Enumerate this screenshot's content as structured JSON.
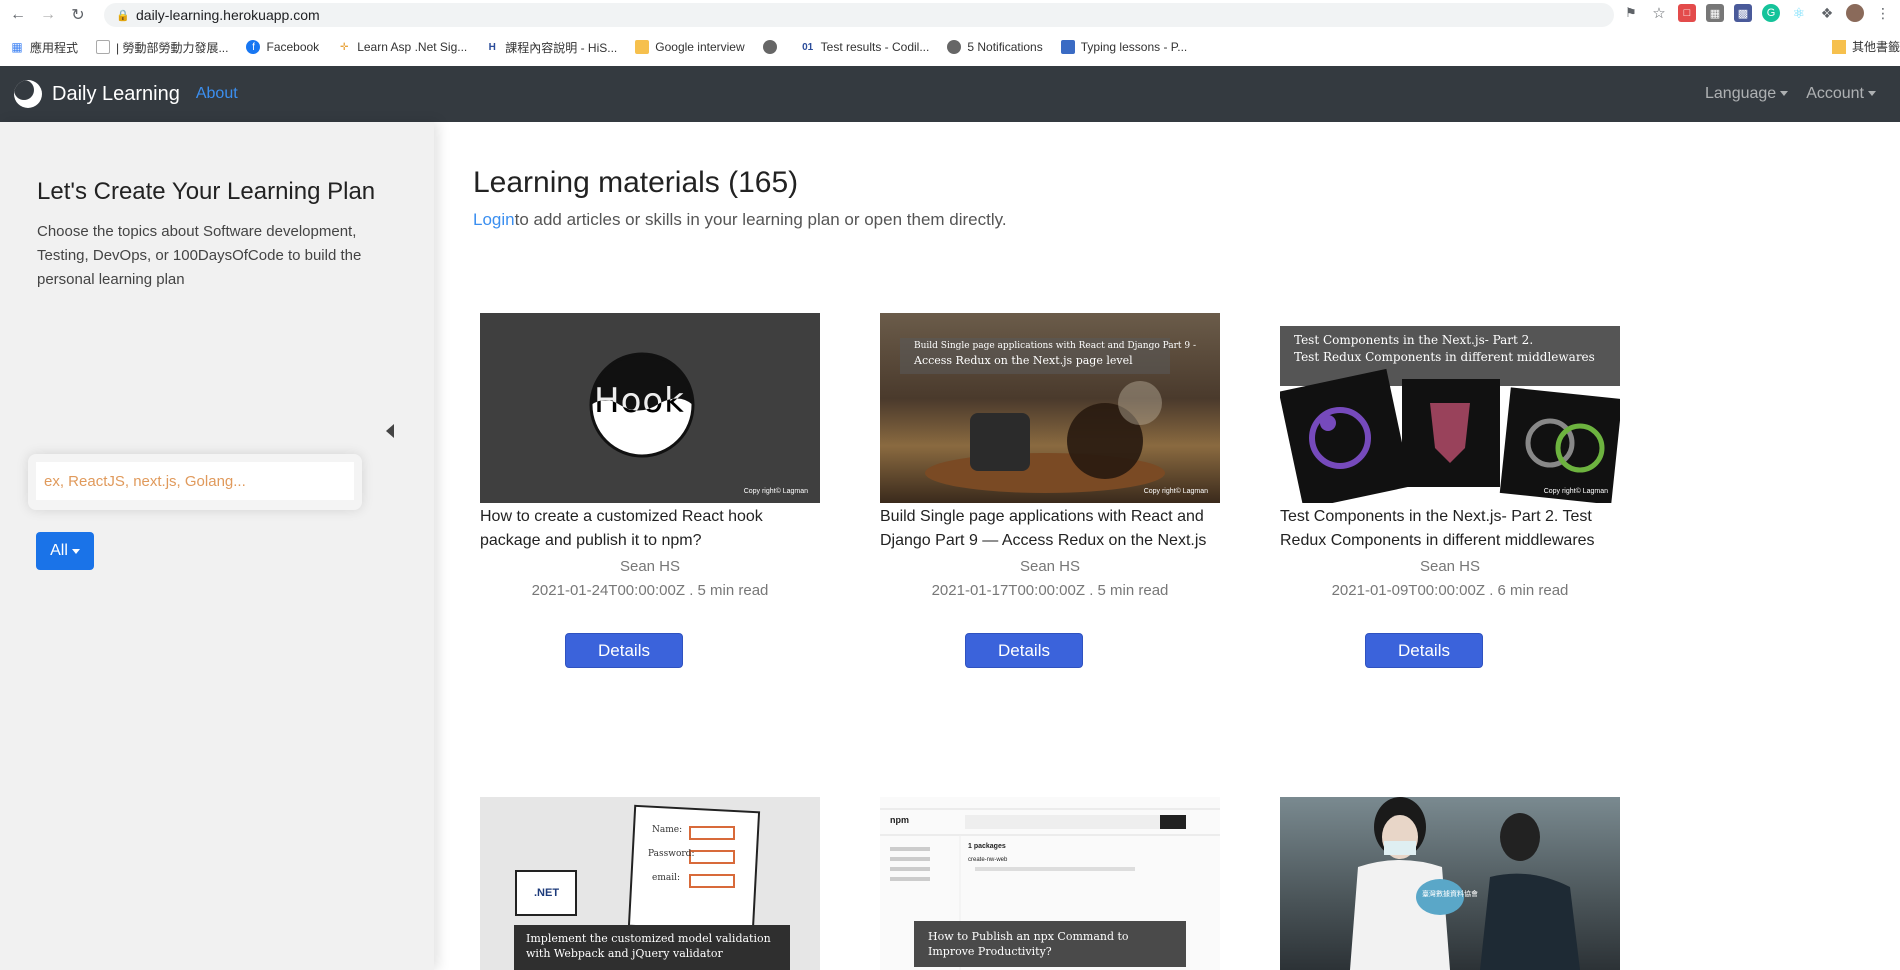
{
  "browser": {
    "url": "daily-learning.herokuapp.com",
    "bookmarks": [
      {
        "label": "應用程式",
        "icon": "apps-grid-icon"
      },
      {
        "label": "| 勞動部勞動力發展...",
        "icon": "page-icon"
      },
      {
        "label": "Facebook",
        "icon": "facebook-icon"
      },
      {
        "label": "Learn Asp .Net Sig...",
        "icon": "bookmark-icon"
      },
      {
        "label": "課程內容說明 - HiS...",
        "icon": "h-icon"
      },
      {
        "label": "Google interview",
        "icon": "folder-icon"
      },
      {
        "label": "",
        "icon": "globe-icon"
      },
      {
        "label": "Test results - Codil...",
        "icon": "codility-icon"
      },
      {
        "label": "5 Notifications",
        "icon": "globe-icon"
      },
      {
        "label": "Typing lessons - P...",
        "icon": "typing-icon"
      }
    ],
    "bookmark_other": "其他書籤"
  },
  "navbar": {
    "brand": "Daily Learning",
    "about": "About",
    "language": "Language",
    "account": "Account"
  },
  "sidebar": {
    "title": "Let's Create Your Learning Plan",
    "description": "Choose the topics about Software development, Testing, DevOps, or 100DaysOfCode to build the personal learning plan",
    "search_placeholder": "ex, ReactJS, next.js, Golang...",
    "filter_label": "All"
  },
  "main": {
    "title": "Learning materials (165)",
    "login_link": "Login",
    "subtitle_rest": "to add articles or skills in your learning plan or open them directly.",
    "details_label": "Details",
    "cards": [
      {
        "title": "How to create a customized React hook package and publish it to npm?",
        "author": "Sean HS",
        "meta": "2021-01-24T00:00:00Z . 5 min read",
        "image_text": "Hook",
        "image_caption": "",
        "copyright": "Copy right© Lagman"
      },
      {
        "title": "Build Single page applications with React and Django Part 9 — Access Redux on the Next.js",
        "author": "Sean HS",
        "meta": "2021-01-17T00:00:00Z . 5 min read",
        "image_text": "Build Single page applications with React and Django Part 9 -",
        "image_caption": "Access Redux on the Next.js page level",
        "copyright": "Copy right© Lagman"
      },
      {
        "title": "Test Components in the Next.js- Part 2. Test Redux Components in different middlewares",
        "author": "Sean HS",
        "meta": "2021-01-09T00:00:00Z . 6 min read",
        "image_text": "Test Components in the Next.js- Part 2.",
        "image_caption": "Test Redux Components in different middlewares",
        "copyright": "Copy right© Lagman"
      },
      {
        "image_text": "Implement the customized model validation",
        "image_caption": "with Webpack and jQuery validator",
        "form_labels": [
          "Name:",
          "Password:",
          "email:"
        ],
        "logo_text": ".NET"
      },
      {
        "image_text": "How to Publish an npx Command to",
        "image_caption": "Improve Productivity?",
        "npm_logo": "npm",
        "npm_heading": "1 packages",
        "npm_package": "create-nw-web"
      },
      {
        "sign_text": "臺灣數據資料協會"
      }
    ]
  }
}
